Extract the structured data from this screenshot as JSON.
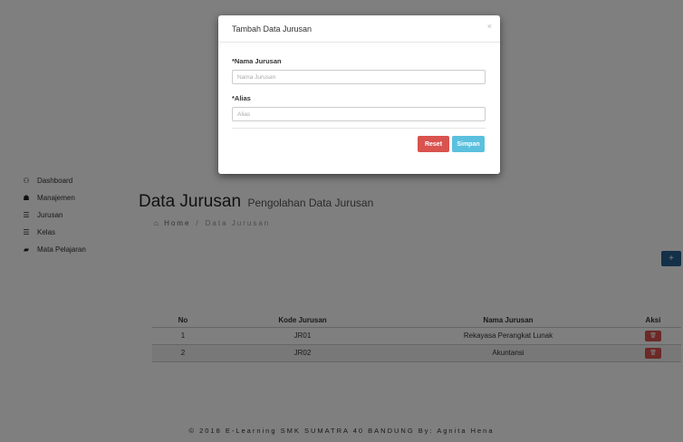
{
  "sidebar": {
    "items": [
      {
        "label": "Dashboard",
        "icon": "dashboard-icon",
        "glyph": "⚇"
      },
      {
        "label": "Manajemen",
        "icon": "users-icon",
        "glyph": "☗"
      },
      {
        "label": "Jurusan",
        "icon": "list-icon",
        "glyph": "☰"
      },
      {
        "label": "Kelas",
        "icon": "list-icon",
        "glyph": "☰"
      },
      {
        "label": "Mata Pelajaran",
        "icon": "book-icon",
        "glyph": "▰"
      }
    ]
  },
  "header": {
    "title": "Data Jurusan",
    "subtitle": "Pengolahan Data Jurusan"
  },
  "breadcrumb": {
    "home_icon": "⌂",
    "home": "Home",
    "separator": "/",
    "current": "Data Jurusan"
  },
  "add_button": {
    "label": "+"
  },
  "table": {
    "headers": [
      "No",
      "Kode Jurusan",
      "Nama Jurusan",
      "Aksi"
    ],
    "rows": [
      {
        "no": "1",
        "kode": "JR01",
        "nama": "Rekayasa Perangkat Lunak",
        "action_glyph": "🗑"
      },
      {
        "no": "2",
        "kode": "JR02",
        "nama": "Akuntansi",
        "action_glyph": "🗑"
      }
    ]
  },
  "footer": {
    "text": "© 2018 E-Learning SMK SUMATRA 40 BANDUNG By: Agnita Hena"
  },
  "modal": {
    "title": "Tambah Data Jurusan",
    "close": "×",
    "fields": {
      "nama_label": "*Nama Jurusan",
      "nama_placeholder": "Nama Jurusan",
      "alias_label": "*Alias",
      "alias_placeholder": "Alias"
    },
    "reset_label": "Reset",
    "save_label": "Simpan"
  },
  "colors": {
    "primary": "#286090",
    "danger": "#d9534f",
    "info": "#5bc0de"
  }
}
